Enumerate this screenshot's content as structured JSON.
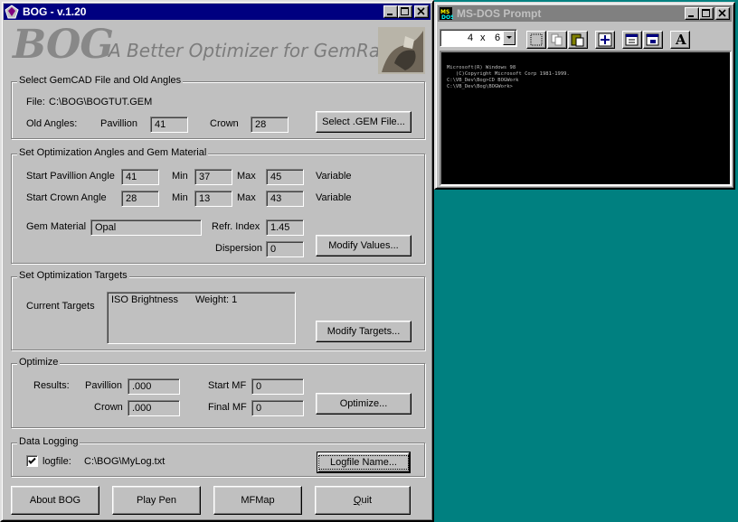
{
  "bog_window": {
    "title": "BOG - v.1.20",
    "logo": {
      "big": "BOG",
      "sub": "A Better Optimizer for GemRay"
    },
    "gemcad_section": {
      "title": "Select GemCAD File and Old Angles",
      "file_label": "File:",
      "file_path": "C:\\BOG\\BOGTUT.GEM",
      "old_angles_label": "Old Angles:",
      "pavilion_label": "Pavillion",
      "pavilion_value": "41",
      "crown_label": "Crown",
      "crown_value": "28",
      "select_button": "Select .GEM File..."
    },
    "angles_section": {
      "title": "Set Optimization Angles and Gem Material",
      "start_pavilion_label": "Start Pavillion Angle",
      "start_pavilion_value": "41",
      "start_crown_label": "Start Crown Angle",
      "start_crown_value": "28",
      "min_label": "Min",
      "max_label": "Max",
      "pavilion_min": "37",
      "pavilion_max": "45",
      "crown_min": "13",
      "crown_max": "43",
      "variable_label": "Variable",
      "gem_material_label": "Gem Material",
      "gem_material_value": "Opal",
      "refr_index_label": "Refr. Index",
      "refr_index_value": "1.45",
      "dispersion_label": "Dispersion",
      "dispersion_value": "0",
      "modify_values_button": "Modify Values..."
    },
    "targets_section": {
      "title": "Set Optimization Targets",
      "current_targets_label": "Current Targets",
      "targets": [
        {
          "name": "ISO Brightness",
          "weight": "Weight:  1"
        }
      ],
      "modify_targets_button": "Modify Targets..."
    },
    "optimize_section": {
      "title": "Optimize",
      "results_label": "Results:",
      "pavilion_label": "Pavillion",
      "pavilion_value": ".000",
      "crown_label": "Crown",
      "crown_value": ".000",
      "start_mf_label": "Start MF",
      "start_mf_value": "0",
      "final_mf_label": "Final MF",
      "final_mf_value": "0",
      "optimize_button": "Optimize..."
    },
    "logging_section": {
      "title": "Data Logging",
      "logfile_label": "logfile:",
      "logfile_checked": true,
      "logfile_path": "C:\\BOG\\MyLog.txt",
      "logfile_button": "Logfile Name..."
    },
    "bottom_buttons": {
      "about": "About BOG",
      "play_pen": "Play Pen",
      "mfmap": "MFMap",
      "quit_first": "Q",
      "quit_rest": "uit"
    }
  },
  "dos_window": {
    "title": "MS-DOS Prompt",
    "font_size_x": "4",
    "font_size_sep": "x",
    "font_size_y": "6",
    "console_lines": [
      "Microsoft(R) Windows 98",
      "   (C)Copyright Microsoft Corp 1981-1999.",
      "",
      "C:\\VB_Dev\\Bog>CD BOGWork",
      "",
      "C:\\VB_Dev\\Bog\\BOGWork>"
    ],
    "toolbar_icons": [
      "mark-icon",
      "copy-icon",
      "paste-icon",
      "fullscreen-icon",
      "properties-icon",
      "background-icon",
      "font-icon"
    ],
    "font_button_glyph": "A"
  },
  "colors": {
    "desktop": "#008080",
    "active_title": "#000080",
    "inactive_title": "#808080",
    "face": "#c0c0c0"
  }
}
